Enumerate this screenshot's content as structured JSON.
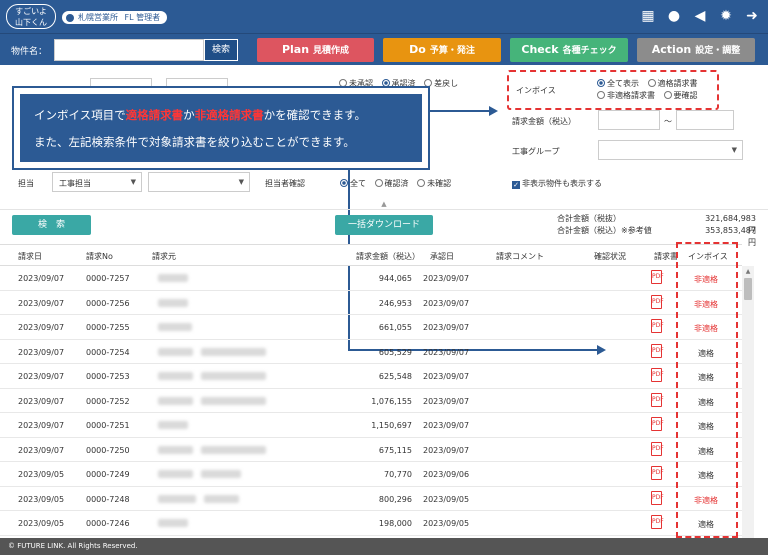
{
  "topbar": {
    "logo_line1": "すごいよ",
    "logo_line2": "山下くん",
    "org": "札幌営業所",
    "role": "FL 管理者",
    "icons": [
      "building-icon",
      "chat-icon",
      "megaphone-icon",
      "gear-icon",
      "logout-icon"
    ]
  },
  "searchbar": {
    "property_label": "物件名：",
    "property_value": "",
    "search_label": "検索"
  },
  "nav": {
    "plan_big": "Plan",
    "plan_label": "見積作成",
    "do_big": "Do",
    "do_label": "予算・発注",
    "check_big": "Check",
    "check_label": "各種チェック",
    "action_big": "Action",
    "action_label": "設定・調整"
  },
  "filters": {
    "approval_radio_1": "未承認",
    "approval_radio_2": "承認済",
    "approval_radio_3": "差戻し",
    "invoice_label": "インボイス",
    "invoice_opt_all": "全て表示",
    "invoice_opt_qualified": "適格請求書",
    "invoice_opt_unqualified": "非適格請求書",
    "invoice_opt_needcheck": "要確認",
    "amount_label": "請求金額（税込）",
    "amount_tilde": "〜",
    "group_label": "工事グループ",
    "tanto_label": "担当",
    "tanto_value": "工事担当",
    "tanto_confirm_label": "担当者確認",
    "confirm_all": "全て",
    "confirm_done": "確認済",
    "confirm_not": "未確認",
    "show_hidden": "非表示物件も表示する"
  },
  "callout": {
    "line1_pre": "インボイス項目で",
    "line1_hl1": "適格請求書",
    "line1_mid": "か",
    "line1_hl2": "非適格請求書",
    "line1_post": "かを確認できます。",
    "line2": "また、左記検索条件で対象請求書を絞り込むことができます。"
  },
  "actions": {
    "search": "検　索",
    "bulk_download": "一括ダウンロード"
  },
  "totals": {
    "excl_label": "合計金額（税抜）",
    "excl_value": "321,684,983 円",
    "incl_label": "合計金額（税込）※参考値",
    "incl_value": "353,853,487 円"
  },
  "table": {
    "headers": {
      "date": "請求日",
      "no": "請求No",
      "from": "請求元",
      "amount": "請求金額（税込）",
      "approved": "承認日",
      "comment": "請求コメント",
      "status": "確認状況",
      "doc": "請求書",
      "invoice": "インボイス"
    },
    "rows": [
      {
        "date": "2023/09/07",
        "no": "0000-7257",
        "amount": "944,065",
        "approved": "2023/09/07",
        "invoice": "非適格",
        "bad": true
      },
      {
        "date": "2023/09/07",
        "no": "0000-7256",
        "amount": "246,953",
        "approved": "2023/09/07",
        "invoice": "非適格",
        "bad": true
      },
      {
        "date": "2023/09/07",
        "no": "0000-7255",
        "amount": "661,055",
        "approved": "2023/09/07",
        "invoice": "非適格",
        "bad": true
      },
      {
        "date": "2023/09/07",
        "no": "0000-7254",
        "amount": "605,529",
        "approved": "2023/09/07",
        "invoice": "適格",
        "bad": false
      },
      {
        "date": "2023/09/07",
        "no": "0000-7253",
        "amount": "625,548",
        "approved": "2023/09/07",
        "invoice": "適格",
        "bad": false
      },
      {
        "date": "2023/09/07",
        "no": "0000-7252",
        "amount": "1,076,155",
        "approved": "2023/09/07",
        "invoice": "適格",
        "bad": false
      },
      {
        "date": "2023/09/07",
        "no": "0000-7251",
        "amount": "1,150,697",
        "approved": "2023/09/07",
        "invoice": "適格",
        "bad": false
      },
      {
        "date": "2023/09/07",
        "no": "0000-7250",
        "amount": "675,115",
        "approved": "2023/09/07",
        "invoice": "適格",
        "bad": false
      },
      {
        "date": "2023/09/05",
        "no": "0000-7249",
        "amount": "70,770",
        "approved": "2023/09/06",
        "invoice": "適格",
        "bad": false
      },
      {
        "date": "2023/09/05",
        "no": "0000-7248",
        "amount": "800,296",
        "approved": "2023/09/05",
        "invoice": "非適格",
        "bad": true
      },
      {
        "date": "2023/09/05",
        "no": "0000-7246",
        "amount": "198,000",
        "approved": "2023/09/05",
        "invoice": "適格",
        "bad": false
      }
    ]
  },
  "footer": "© FUTURE LINK. All Rights Reserved.",
  "colors": {
    "primary": "#2c5a94",
    "plan": "#dd5560",
    "do": "#e89410",
    "check": "#46b47a",
    "action": "#8c8c8c",
    "teal": "#3aa8a5",
    "alert": "#e53333"
  }
}
